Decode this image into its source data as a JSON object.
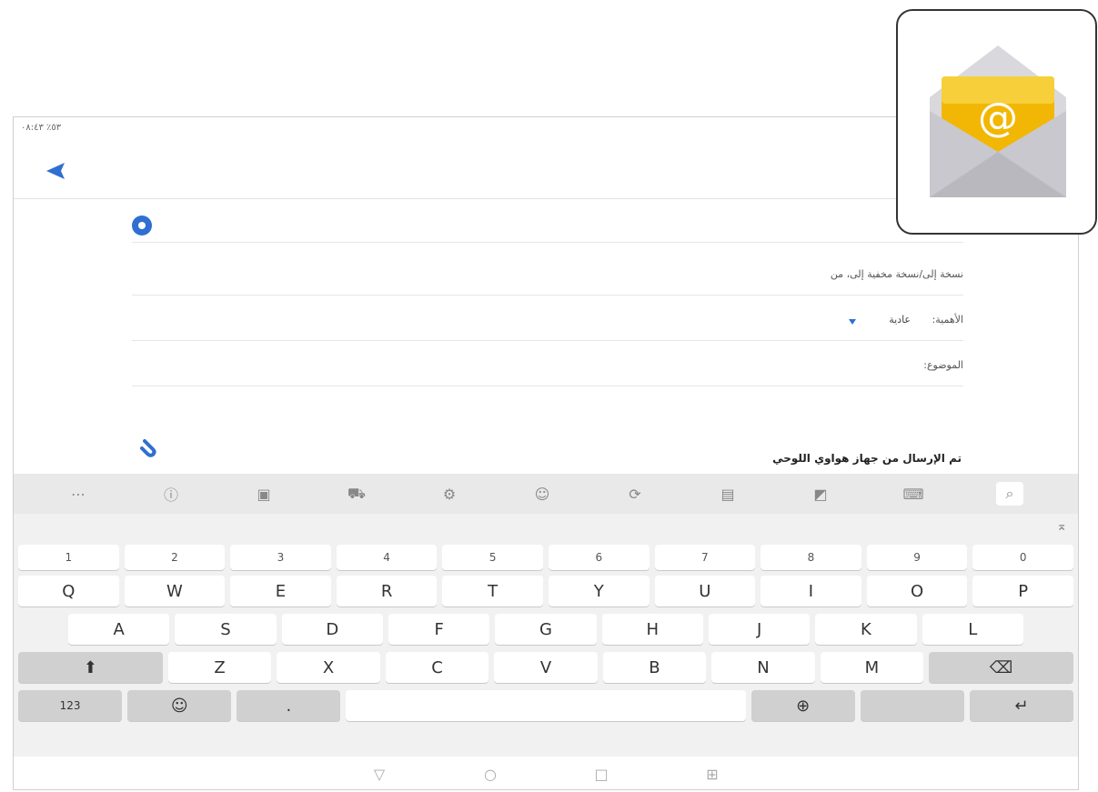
{
  "status_bar": {
    "text": "٥٣٪ ٠٨:٤٣"
  },
  "compose": {
    "cc_bcc_label": "نسخة إلى/نسخة مخفية إلى، من",
    "priority_label": "الأهمية:",
    "priority_value": "عادية",
    "subject_label": "الموضوع:",
    "signature": "تم الإرسال من جهاز هواوي اللوحي"
  },
  "keyboard": {
    "number_row": [
      "1",
      "2",
      "3",
      "4",
      "5",
      "6",
      "7",
      "8",
      "9",
      "0"
    ],
    "row1": [
      "Q",
      "W",
      "E",
      "R",
      "T",
      "Y",
      "U",
      "I",
      "O",
      "P"
    ],
    "row2": [
      "A",
      "S",
      "D",
      "F",
      "G",
      "H",
      "J",
      "K",
      "L"
    ],
    "row3": [
      "Z",
      "X",
      "C",
      "V",
      "B",
      "N",
      "M"
    ],
    "mode_key": "123",
    "period_key": "."
  },
  "icons": {
    "app": "email-app-icon",
    "send": "send-icon",
    "toolbar": [
      "more-icon",
      "info-icon",
      "gallery-icon",
      "car-icon",
      "settings-icon",
      "emoji-icon",
      "sync-icon",
      "clipboard-icon",
      "sticker-icon",
      "keyboard-icon",
      "search-icon"
    ]
  },
  "colors": {
    "accent": "#2f6fd1",
    "envelope_yellow": "#f2b705"
  }
}
